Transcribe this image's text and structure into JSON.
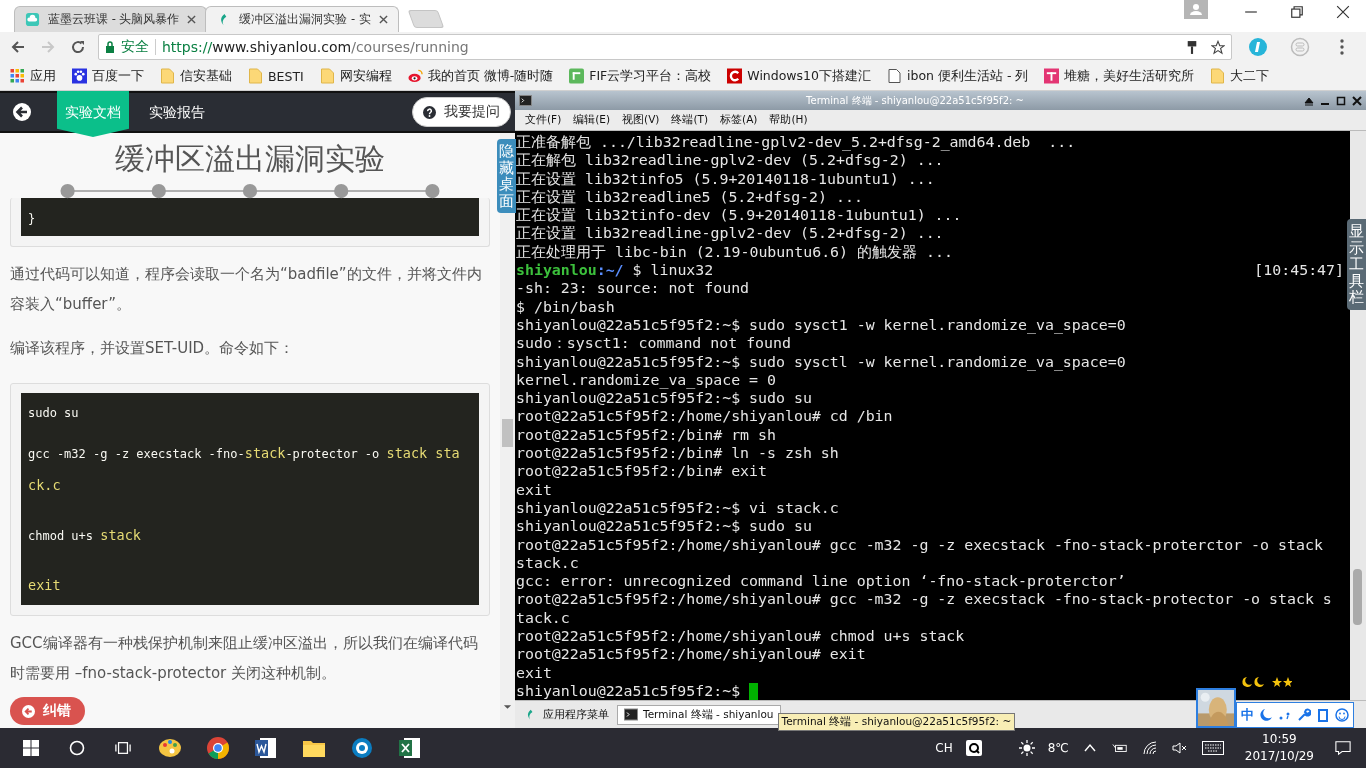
{
  "browser": {
    "tabs": [
      {
        "title": "蓝墨云班课 - 头脑风暴作",
        "selected": false
      },
      {
        "title": "缓冲区溢出漏洞实验 - 实",
        "selected": true
      }
    ],
    "security": "安全",
    "url_scheme": "https://",
    "url_host": "www.shiyanlou.com",
    "url_path": "/courses/running",
    "bookmarks": [
      "应用",
      "百度一下",
      "信安基础",
      "BESTI",
      "网安编程",
      "我的首页 微博-随时随",
      "FIF云学习平台：高校",
      "Windows10下搭建汇",
      "ibon 便利生活站 - 列",
      "堆糖，美好生活研究所",
      "大二下"
    ]
  },
  "doc": {
    "tabs": [
      {
        "label": "实验文档",
        "selected": true
      },
      {
        "label": "实验报告",
        "selected": false
      }
    ],
    "ask_button": "我要提问",
    "title": "缓冲区溢出漏洞实验",
    "code_tail": "}",
    "para_1": "通过代码可以知道，程序会读取一个名为“badfile”的文件，并将文件内容装入“buffer”。",
    "para_2": "编译该程序，并设置SET-UID。命令如下：",
    "code_lines": [
      {
        "segments": [
          {
            "text": "sudo su",
            "kind": "plain"
          }
        ]
      },
      {
        "segments": [
          {
            "text": "gcc -m32 -g -z execstack -fno-",
            "kind": "plain"
          },
          {
            "text": "stack",
            "kind": "keyword"
          },
          {
            "text": "-protector -o ",
            "kind": "plain"
          },
          {
            "text": "stack sta",
            "kind": "keyword"
          }
        ]
      },
      {
        "segments": [
          {
            "text": "ck.c",
            "kind": "keyword"
          }
        ]
      },
      {
        "segments": [
          {
            "text": "chmod u+s ",
            "kind": "plain"
          },
          {
            "text": "stack",
            "kind": "keyword"
          }
        ]
      },
      {
        "segments": [
          {
            "text": "exit",
            "kind": "keyword"
          }
        ]
      }
    ],
    "para_3": "GCC编译器有一种栈保护机制来阻止缓冲区溢出，所以我们在编译代码时需要用 –fno-stack-protector 关闭这种机制。",
    "report_button": "纠错",
    "hide_desktop": "隐藏桌面"
  },
  "terminal": {
    "title": "Terminal 终端 - shiyanlou@22a51c5f95f2: ~",
    "menus": [
      "文件(F)",
      "编辑(E)",
      "视图(V)",
      "终端(T)",
      "标签(A)",
      "帮助(H)"
    ],
    "lines": [
      {
        "kind": "text",
        "text": "正准备解包 .../lib32readline-gplv2-dev_5.2+dfsg-2_amd64.deb  ..."
      },
      {
        "kind": "text",
        "text": "正在解包 lib32readline-gplv2-dev (5.2+dfsg-2) ..."
      },
      {
        "kind": "text",
        "text": "正在设置 lib32tinfo5 (5.9+20140118-1ubuntu1) ..."
      },
      {
        "kind": "text",
        "text": "正在设置 lib32readline5 (5.2+dfsg-2) ..."
      },
      {
        "kind": "text",
        "text": "正在设置 lib32tinfo-dev (5.9+20140118-1ubuntu1) ..."
      },
      {
        "kind": "text",
        "text": "正在设置 lib32readline-gplv2-dev (5.2+dfsg-2) ..."
      },
      {
        "kind": "text",
        "text": "正在处理用于 libc-bin (2.19-0ubuntu6.6) 的触发器 ..."
      },
      {
        "kind": "prompt",
        "user": "shiyanlou",
        "path": ":~/",
        "text": " $ linux32",
        "time": "[10:45:47]"
      },
      {
        "kind": "text",
        "text": "-sh: 23: source: not found"
      },
      {
        "kind": "text",
        "text": "$ /bin/bash"
      },
      {
        "kind": "text",
        "text": "shiyanlou@22a51c5f95f2:~$ sudo sysct1 -w kernel.randomize_va_space=0"
      },
      {
        "kind": "text",
        "text": "sudo：sysct1: command not found"
      },
      {
        "kind": "text",
        "text": "shiyanlou@22a51c5f95f2:~$ sudo sysctl -w kernel.randomize_va_space=0"
      },
      {
        "kind": "text",
        "text": "kernel.randomize_va_space = 0"
      },
      {
        "kind": "text",
        "text": "shiyanlou@22a51c5f95f2:~$ sudo su"
      },
      {
        "kind": "text",
        "text": "root@22a51c5f95f2:/home/shiyanlou# cd /bin"
      },
      {
        "kind": "text",
        "text": "root@22a51c5f95f2:/bin# rm sh"
      },
      {
        "kind": "text",
        "text": "root@22a51c5f95f2:/bin# ln -s zsh sh"
      },
      {
        "kind": "text",
        "text": "root@22a51c5f95f2:/bin# exit"
      },
      {
        "kind": "text",
        "text": "exit"
      },
      {
        "kind": "text",
        "text": "shiyanlou@22a51c5f95f2:~$ vi stack.c"
      },
      {
        "kind": "text",
        "text": "shiyanlou@22a51c5f95f2:~$ sudo su"
      },
      {
        "kind": "text",
        "text": "root@22a51c5f95f2:/home/shiyanlou# gcc -m32 -g -z execstack -fno-stack-proterctor -o stack"
      },
      {
        "kind": "text",
        "text": "stack.c"
      },
      {
        "kind": "text",
        "text": "gcc: error: unrecognized command line option ‘-fno-stack-proterctor’"
      },
      {
        "kind": "text",
        "text": "root@22a51c5f95f2:/home/shiyanlou# gcc -m32 -g -z execstack -fno-stack-protector -o stack s"
      },
      {
        "kind": "text",
        "text": "tack.c"
      },
      {
        "kind": "text",
        "text": "root@22a51c5f95f2:/home/shiyanlou# chmod u+s stack"
      },
      {
        "kind": "text",
        "text": "root@22a51c5f95f2:/home/shiyanlou# exit"
      },
      {
        "kind": "text",
        "text": "exit"
      },
      {
        "kind": "cursor",
        "text": "shiyanlou@22a51c5f95f2:~$ "
      }
    ],
    "show_toolbar": "显示工具栏"
  },
  "desktop_panel": {
    "menu": "应用程序菜单",
    "task": "Terminal 终端 - shiyanlou",
    "tooltip": "Terminal 终端 - shiyanlou@22a51c5f95f2: ~",
    "ime": "中"
  },
  "taskbar": {
    "lang": "CH",
    "temperature": "8℃",
    "time": "10:59",
    "date": "2017/10/29"
  }
}
